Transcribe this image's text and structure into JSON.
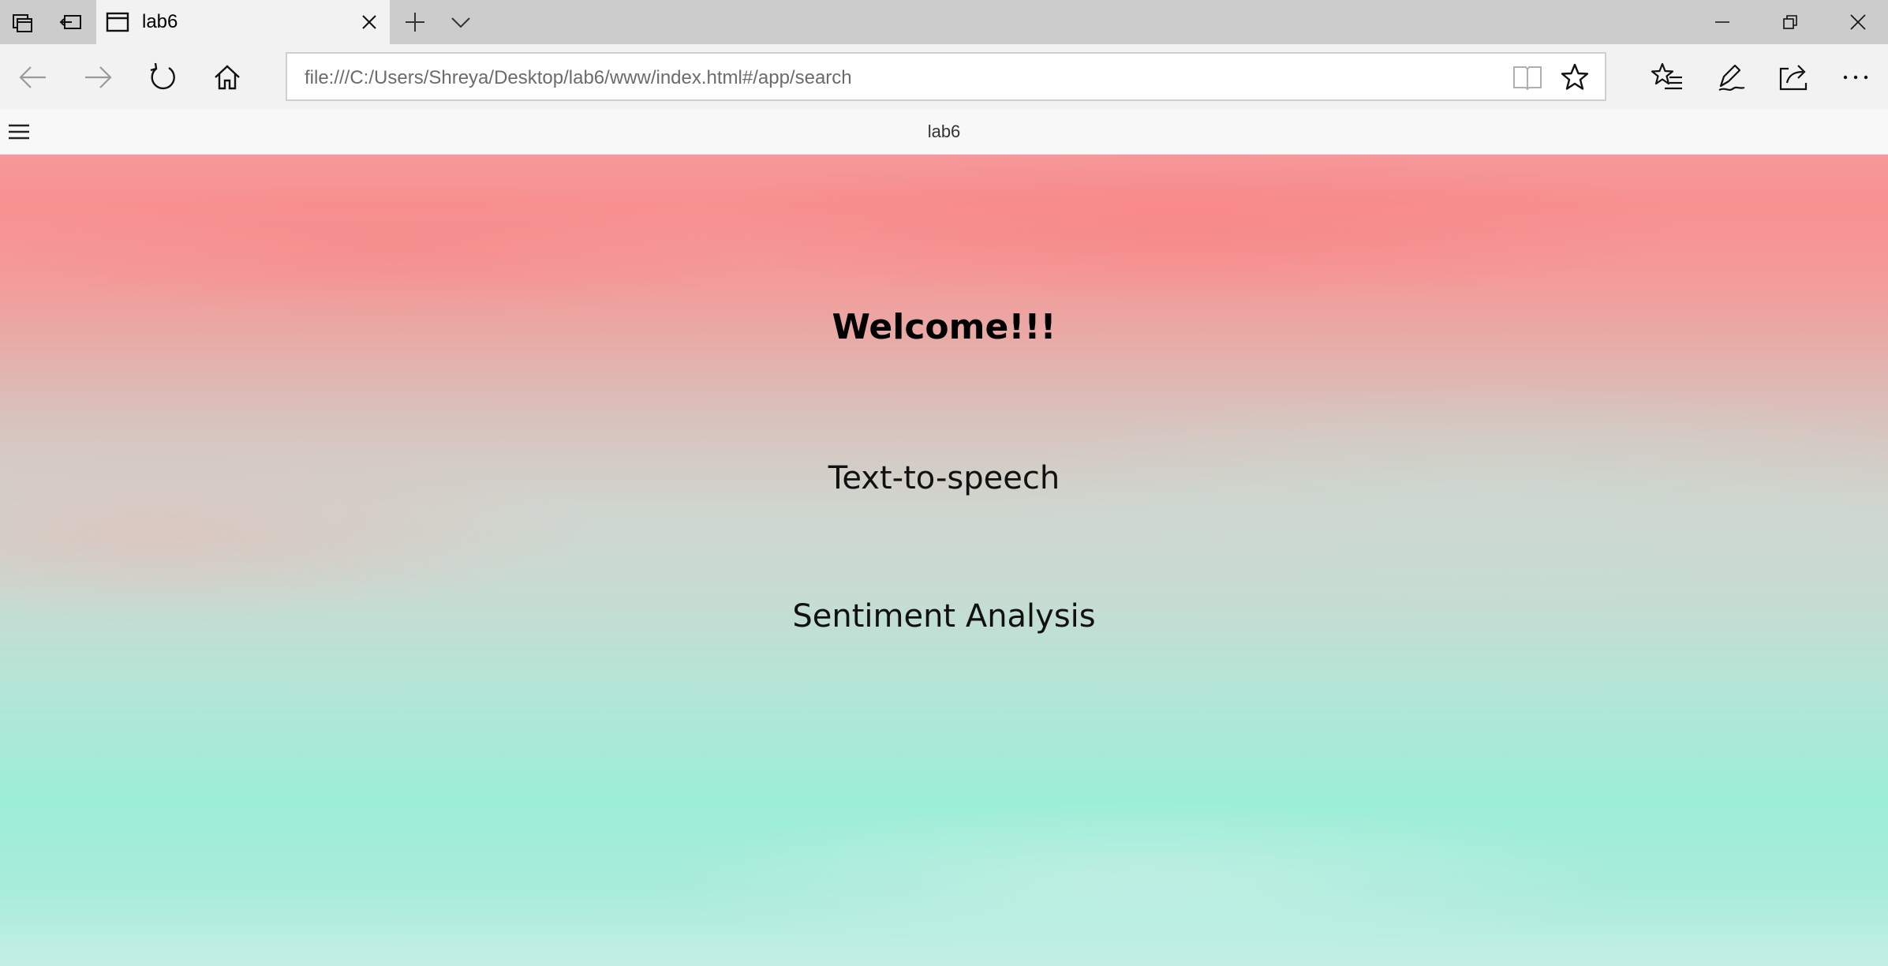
{
  "browser": {
    "tab": {
      "title": "lab6"
    },
    "address_bar": {
      "url": "file:///C:/Users/Shreya/Desktop/lab6/www/index.html#/app/search"
    },
    "icons": {
      "tab_preview": "tab-preview-icon",
      "set_aside": "set-aside-tabs-icon",
      "favicon": "page-favicon-icon",
      "close_tab": "close-icon",
      "new_tab": "plus-icon",
      "tab_list": "chevron-down-icon",
      "minimize": "minimize-icon",
      "restore": "restore-icon",
      "close_window": "close-icon",
      "back": "back-arrow-icon",
      "forward": "forward-arrow-icon",
      "refresh": "refresh-icon",
      "home": "home-icon",
      "reading_view": "reading-view-icon",
      "favorite": "star-icon",
      "favorites_hub": "favorites-hub-icon",
      "web_note": "pen-icon",
      "share": "share-icon",
      "more": "more-icon"
    }
  },
  "app": {
    "header": {
      "title": "lab6",
      "menu_icon": "hamburger-icon"
    },
    "main": {
      "heading": "Welcome!!!",
      "links": [
        {
          "label": "Text-to-speech"
        },
        {
          "label": "Sentiment Analysis"
        }
      ]
    }
  }
}
